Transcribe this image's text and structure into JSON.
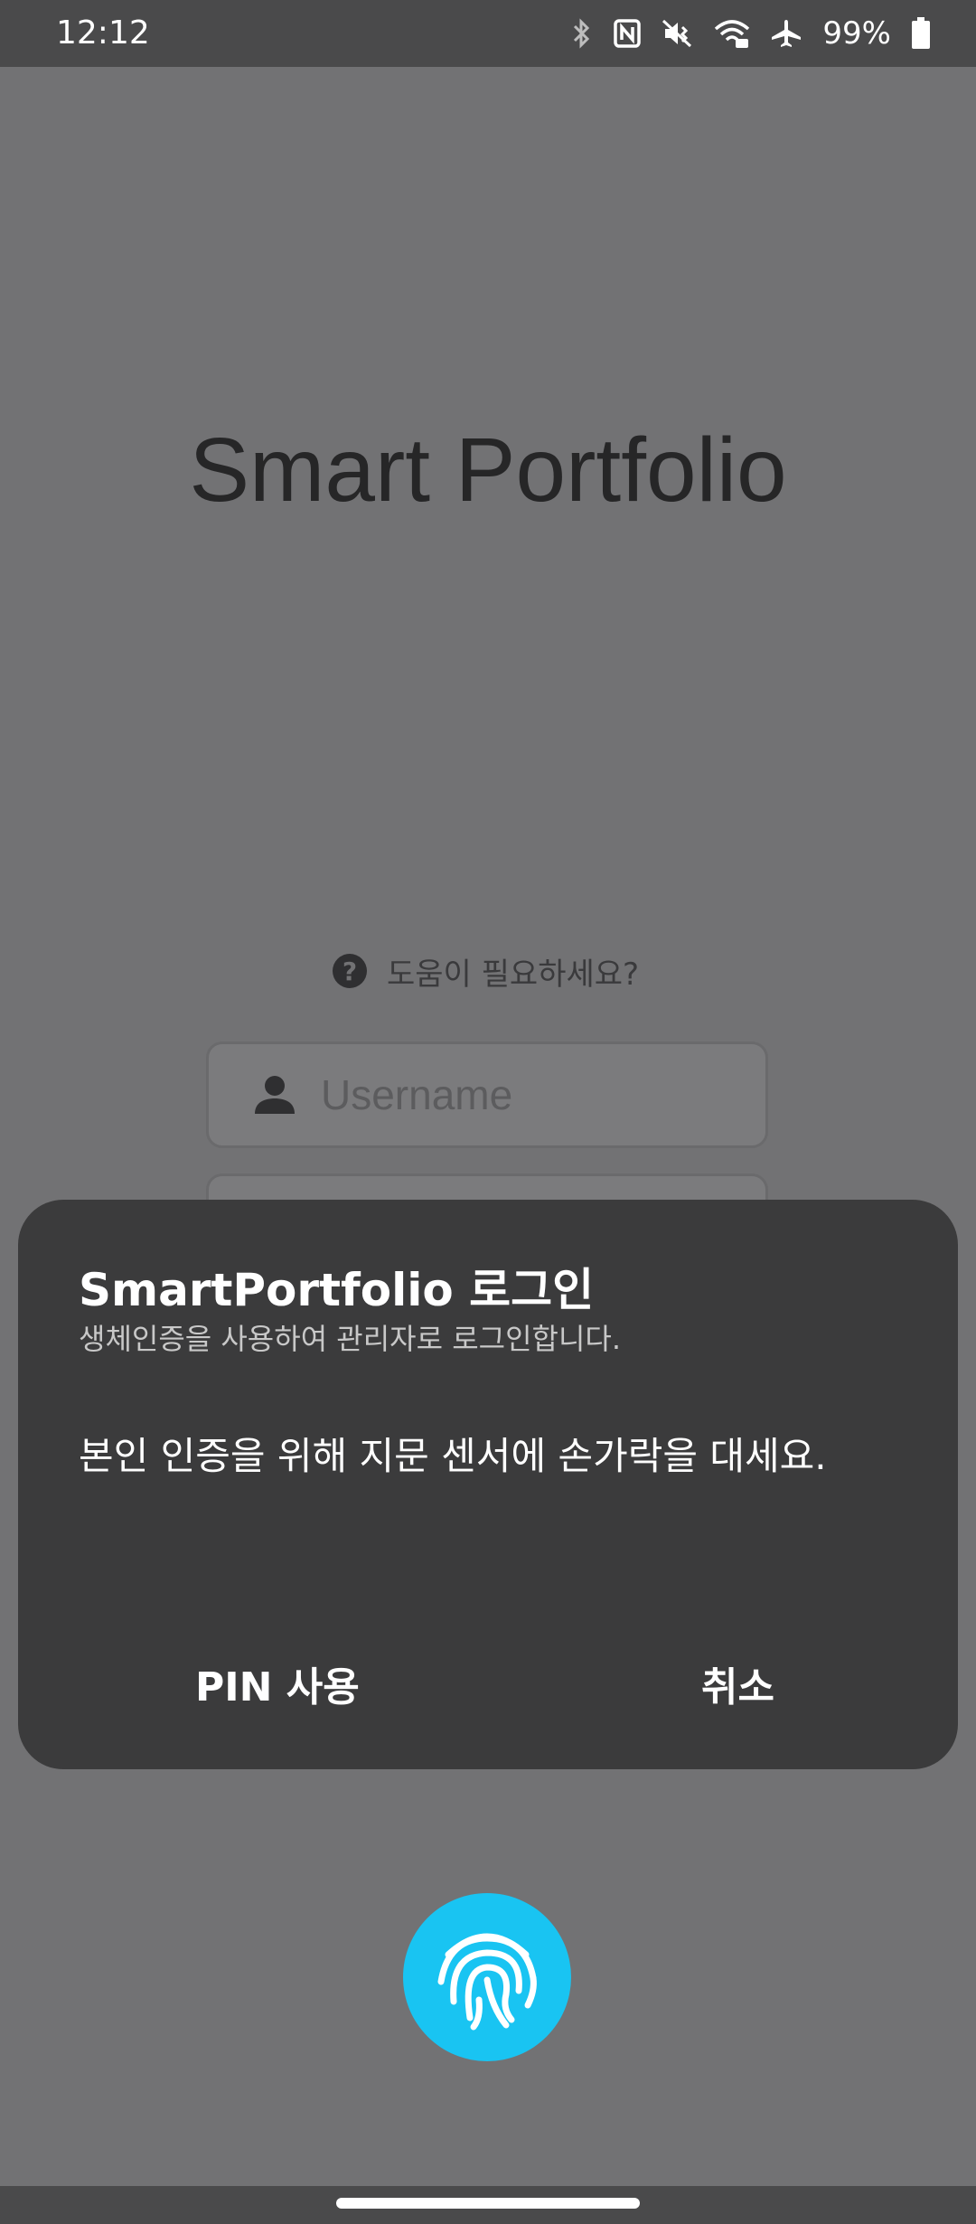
{
  "status_bar": {
    "time": "12:12",
    "battery_percent": "99%",
    "icons": [
      "bluetooth-icon",
      "nfc-icon",
      "vibrate-icon",
      "wifi-icon",
      "airplane-icon",
      "battery-icon"
    ]
  },
  "app": {
    "title": "Smart Portfolio",
    "help_text": "도움이 필요하세요?",
    "username_placeholder": "Username"
  },
  "dialog": {
    "title": "SmartPortfolio 로그인",
    "subtitle": "생체인증을 사용하여 관리자로 로그인합니다.",
    "message": "본인 인증을 위해 지문 센서에 손가락을 대세요.",
    "pin_button": "PIN 사용",
    "cancel_button": "취소"
  },
  "colors": {
    "accent": "#19c4f2",
    "dialog_bg": "#3b3b3c",
    "scrim_bg": "#727274"
  }
}
